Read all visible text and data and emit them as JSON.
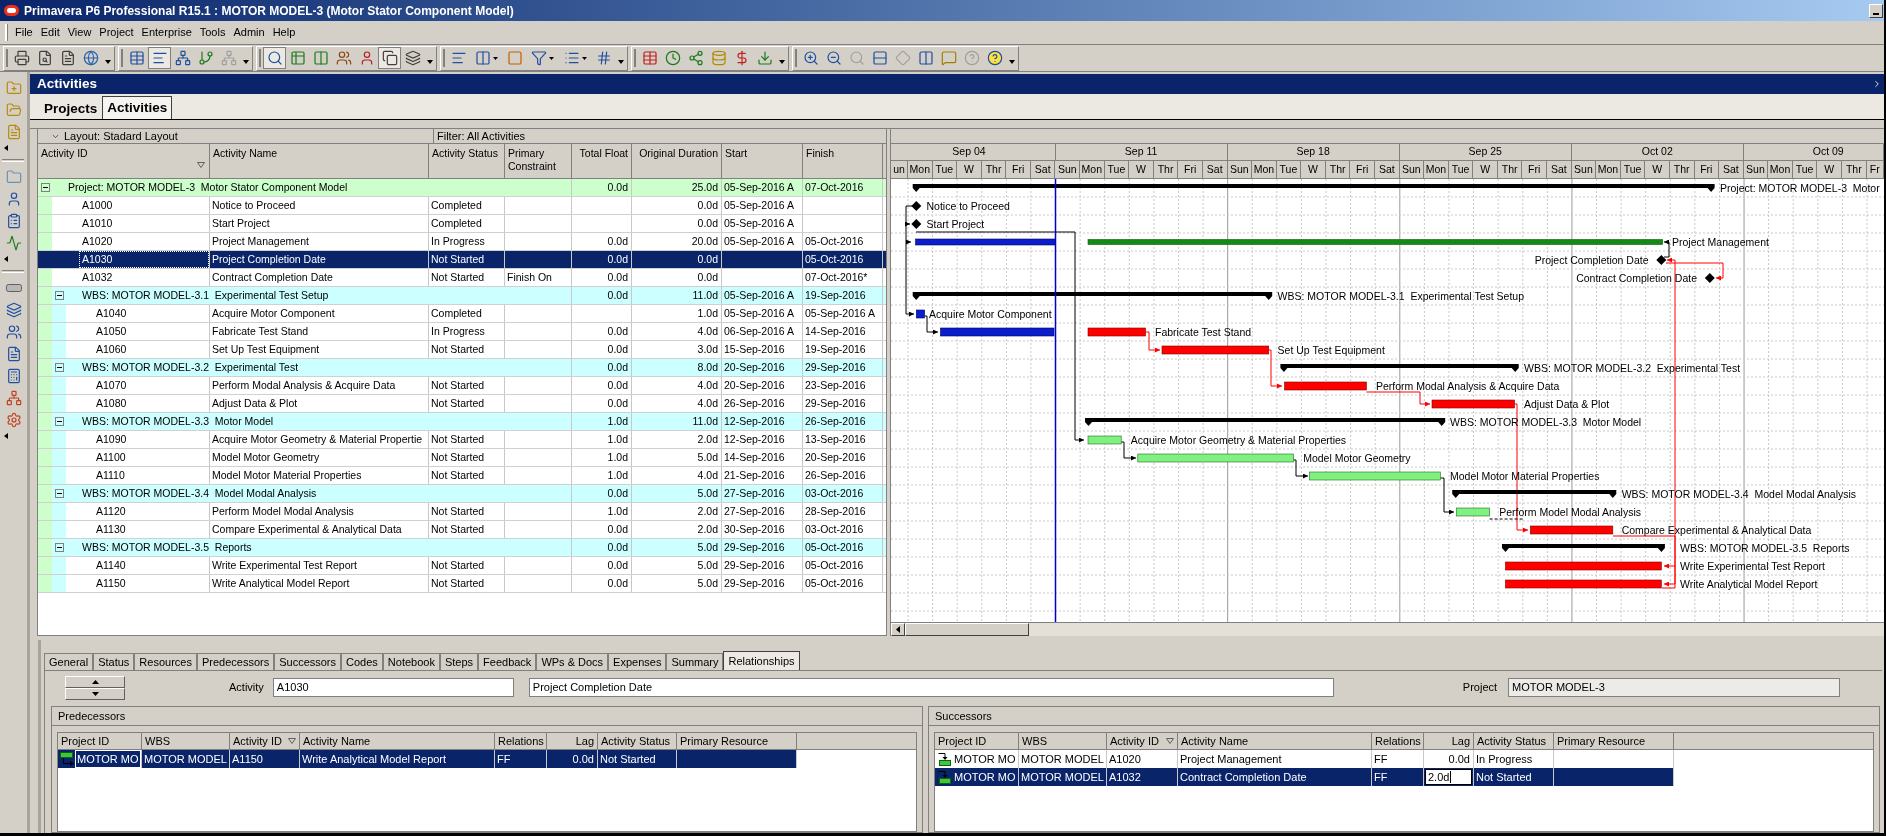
{
  "window": {
    "title": "Primavera P6 Professional R15.1 : MOTOR MODEL-3 (Motor Stator Component Model)"
  },
  "menu": [
    "File",
    "Edit",
    "View",
    "Project",
    "Enterprise",
    "Tools",
    "Admin",
    "Help"
  ],
  "toolbar": [
    {
      "buttons": [
        {
          "kind": "print",
          "pressed": false,
          "disabled": false,
          "dropdown": false
        },
        {
          "kind": "print_preview",
          "pressed": false,
          "disabled": false,
          "dropdown": false
        },
        {
          "kind": "page_setup",
          "pressed": false,
          "disabled": false,
          "dropdown": false
        },
        {
          "kind": "publish",
          "pressed": false,
          "disabled": false,
          "dropdown": false
        }
      ]
    },
    {
      "buttons": [
        {
          "kind": "table",
          "pressed": false,
          "disabled": false,
          "dropdown": false
        },
        {
          "kind": "gantt",
          "pressed": true,
          "disabled": false,
          "dropdown": false
        },
        {
          "kind": "network",
          "pressed": false,
          "disabled": false,
          "dropdown": false
        },
        {
          "kind": "trace_logic",
          "pressed": false,
          "disabled": false,
          "dropdown": false
        },
        {
          "kind": "hierarchy",
          "pressed": false,
          "disabled": true,
          "dropdown": false
        }
      ]
    },
    {
      "buttons": [
        {
          "kind": "details",
          "pressed": true,
          "disabled": false,
          "dropdown": false
        },
        {
          "kind": "activity_table",
          "pressed": false,
          "disabled": false,
          "dropdown": false
        },
        {
          "kind": "histogram",
          "pressed": false,
          "disabled": false,
          "dropdown": false
        },
        {
          "kind": "resource_usage",
          "pressed": false,
          "disabled": false,
          "dropdown": false
        },
        {
          "kind": "resource_profile",
          "pressed": false,
          "disabled": false,
          "dropdown": false
        },
        {
          "kind": "assignments",
          "pressed": true,
          "disabled": false,
          "dropdown": false
        },
        {
          "kind": "layers",
          "pressed": false,
          "disabled": false,
          "dropdown": false
        }
      ]
    },
    {
      "buttons": [
        {
          "kind": "bars",
          "pressed": false,
          "disabled": false,
          "dropdown": false
        },
        {
          "kind": "columns",
          "pressed": false,
          "disabled": false,
          "dropdown": true
        },
        {
          "kind": "filter_bar",
          "pressed": false,
          "disabled": false,
          "dropdown": false
        },
        {
          "kind": "filter",
          "pressed": false,
          "disabled": false,
          "dropdown": true
        },
        {
          "kind": "group",
          "pressed": false,
          "disabled": false,
          "dropdown": true
        },
        {
          "kind": "number",
          "pressed": false,
          "disabled": false,
          "dropdown": false
        }
      ]
    },
    {
      "buttons": [
        {
          "kind": "spreadsheet",
          "pressed": false,
          "disabled": false,
          "dropdown": false
        },
        {
          "kind": "schedule",
          "pressed": false,
          "disabled": false,
          "dropdown": false
        },
        {
          "kind": "level",
          "pressed": false,
          "disabled": false,
          "dropdown": false
        },
        {
          "kind": "store",
          "pressed": false,
          "disabled": false,
          "dropdown": false
        },
        {
          "kind": "dollar",
          "pressed": false,
          "disabled": false,
          "dropdown": false
        },
        {
          "kind": "update",
          "pressed": false,
          "disabled": false,
          "dropdown": false
        }
      ]
    },
    {
      "buttons": [
        {
          "kind": "zoom_in",
          "pressed": false,
          "disabled": false,
          "dropdown": false
        },
        {
          "kind": "zoom_out",
          "pressed": false,
          "disabled": false,
          "dropdown": false
        },
        {
          "kind": "zoom_fit",
          "pressed": false,
          "disabled": true,
          "dropdown": false
        },
        {
          "kind": "rows",
          "pressed": false,
          "disabled": false,
          "dropdown": false
        },
        {
          "kind": "diamond",
          "pressed": false,
          "disabled": true,
          "dropdown": false
        },
        {
          "kind": "columns2",
          "pressed": false,
          "disabled": false,
          "dropdown": false
        },
        {
          "kind": "comment",
          "pressed": false,
          "disabled": false,
          "dropdown": false
        },
        {
          "kind": "help",
          "pressed": false,
          "disabled": true,
          "dropdown": false
        },
        {
          "kind": "help_online",
          "pressed": false,
          "disabled": false,
          "dropdown": false
        }
      ]
    }
  ],
  "panel": {
    "title": "Activities"
  },
  "tabs": [
    {
      "label": "Projects",
      "selected": false
    },
    {
      "label": "Activities",
      "selected": true
    }
  ],
  "layout_bar": {
    "layout": "Layout: Stadard Layout",
    "filter": "Filter: All Activities"
  },
  "table": {
    "columns": [
      {
        "label": "Activity ID",
        "sorted": true
      },
      {
        "label": "Activity Name",
        "sorted": false
      },
      {
        "label": "Activity Status",
        "sorted": false
      },
      {
        "label": "Primary Constraint",
        "sorted": false
      },
      {
        "label": "Total Float",
        "sorted": false
      },
      {
        "label": "Original Duration",
        "sorted": false
      },
      {
        "label": "Start",
        "sorted": false
      },
      {
        "label": "Finish",
        "sorted": false
      }
    ],
    "rows": [
      {
        "kind": "project",
        "label": "Project: MOTOR MODEL-3  Motor Stator Component Model",
        "expanded": true,
        "selected": false,
        "total_float": "0.0d",
        "original_duration": "25.0d",
        "start": "05-Sep-2016 A",
        "finish": "07-Oct-2016",
        "children": [
          {
            "kind": "activity",
            "id": "A1000",
            "name": "Notice to Proceed",
            "status": "Completed",
            "original_duration": "0.0d",
            "start": "05-Sep-2016 A",
            "selected": false
          },
          {
            "kind": "activity",
            "id": "A1010",
            "name": "Start Project",
            "status": "Completed",
            "original_duration": "0.0d",
            "start": "05-Sep-2016 A",
            "selected": false
          },
          {
            "kind": "activity",
            "id": "A1020",
            "name": "Project Management",
            "status": "In Progress",
            "total_float": "0.0d",
            "original_duration": "20.0d",
            "start": "05-Sep-2016 A",
            "finish": "05-Oct-2016",
            "selected": false
          },
          {
            "kind": "activity",
            "id": "A1030",
            "name": "Project Completion Date",
            "status": "Not Started",
            "total_float": "0.0d",
            "original_duration": "0.0d",
            "finish": "05-Oct-2016",
            "selected": true
          },
          {
            "kind": "activity",
            "id": "A1032",
            "name": "Contract Completion Date",
            "status": "Not Started",
            "primary_constraint": "Finish On",
            "total_float": "0.0d",
            "original_duration": "0.0d",
            "finish": "07-Oct-2016*",
            "selected": false
          },
          {
            "kind": "wbs",
            "label": "WBS: MOTOR MODEL-3.1  Experimental Test Setup",
            "expanded": true,
            "selected": false,
            "total_float": "0.0d",
            "original_duration": "11.0d",
            "start": "05-Sep-2016 A",
            "finish": "19-Sep-2016",
            "children": [
              {
                "kind": "activity",
                "id": "A1040",
                "name": "Acquire Motor Component",
                "status": "Completed",
                "original_duration": "1.0d",
                "start": "05-Sep-2016 A",
                "finish": "05-Sep-2016 A",
                "selected": false
              },
              {
                "kind": "activity",
                "id": "A1050",
                "name": "Fabricate Test Stand",
                "status": "In Progress",
                "total_float": "0.0d",
                "original_duration": "4.0d",
                "start": "06-Sep-2016 A",
                "finish": "14-Sep-2016",
                "selected": false
              },
              {
                "kind": "activity",
                "id": "A1060",
                "name": "Set Up Test Equipment",
                "status": "Not Started",
                "total_float": "0.0d",
                "original_duration": "3.0d",
                "start": "15-Sep-2016",
                "finish": "19-Sep-2016",
                "selected": false
              }
            ]
          },
          {
            "kind": "wbs",
            "label": "WBS: MOTOR MODEL-3.2  Experimental Test",
            "expanded": true,
            "selected": false,
            "total_float": "0.0d",
            "original_duration": "8.0d",
            "start": "20-Sep-2016",
            "finish": "29-Sep-2016",
            "children": [
              {
                "kind": "activity",
                "id": "A1070",
                "name": "Perform Modal Analysis & Acquire Data",
                "status": "Not Started",
                "total_float": "0.0d",
                "original_duration": "4.0d",
                "start": "20-Sep-2016",
                "finish": "23-Sep-2016",
                "selected": false
              },
              {
                "kind": "activity",
                "id": "A1080",
                "name": "Adjust Data & Plot",
                "status": "Not Started",
                "total_float": "0.0d",
                "original_duration": "4.0d",
                "start": "26-Sep-2016",
                "finish": "29-Sep-2016",
                "selected": false
              }
            ]
          },
          {
            "kind": "wbs",
            "label": "WBS: MOTOR MODEL-3.3  Motor Model",
            "expanded": true,
            "selected": false,
            "total_float": "1.0d",
            "original_duration": "11.0d",
            "start": "12-Sep-2016",
            "finish": "26-Sep-2016",
            "children": [
              {
                "kind": "activity",
                "id": "A1090",
                "name": "Acquire Motor Geometry & Material Propertie",
                "status": "Not Started",
                "total_float": "1.0d",
                "original_duration": "2.0d",
                "start": "12-Sep-2016",
                "finish": "13-Sep-2016",
                "selected": false
              },
              {
                "kind": "activity",
                "id": "A1100",
                "name": "Model Motor Geometry",
                "status": "Not Started",
                "total_float": "1.0d",
                "original_duration": "5.0d",
                "start": "14-Sep-2016",
                "finish": "20-Sep-2016",
                "selected": false
              },
              {
                "kind": "activity",
                "id": "A1110",
                "name": "Model Motor Material Properties",
                "status": "Not Started",
                "total_float": "1.0d",
                "original_duration": "4.0d",
                "start": "21-Sep-2016",
                "finish": "26-Sep-2016",
                "selected": false
              }
            ]
          },
          {
            "kind": "wbs",
            "label": "WBS: MOTOR MODEL-3.4  Model Modal Analysis",
            "expanded": true,
            "selected": false,
            "total_float": "0.0d",
            "original_duration": "5.0d",
            "start": "27-Sep-2016",
            "finish": "03-Oct-2016",
            "children": [
              {
                "kind": "activity",
                "id": "A1120",
                "name": "Perform Model Modal Analysis",
                "status": "Not Started",
                "total_float": "1.0d",
                "original_duration": "2.0d",
                "start": "27-Sep-2016",
                "finish": "28-Sep-2016",
                "selected": false
              },
              {
                "kind": "activity",
                "id": "A1130",
                "name": "Compare Experimental & Analytical Data",
                "status": "Not Started",
                "total_float": "0.0d",
                "original_duration": "2.0d",
                "start": "30-Sep-2016",
                "finish": "03-Oct-2016",
                "selected": false
              }
            ]
          },
          {
            "kind": "wbs",
            "label": "WBS: MOTOR MODEL-3.5  Reports",
            "expanded": true,
            "selected": false,
            "total_float": "0.0d",
            "original_duration": "5.0d",
            "start": "29-Sep-2016",
            "finish": "05-Oct-2016",
            "children": [
              {
                "kind": "activity",
                "id": "A1140",
                "name": "Write Experimental Test Report",
                "status": "Not Started",
                "total_float": "0.0d",
                "original_duration": "5.0d",
                "start": "29-Sep-2016",
                "finish": "05-Oct-2016",
                "selected": false
              },
              {
                "kind": "activity",
                "id": "A1150",
                "name": "Write Analytical Model Report",
                "status": "Not Started",
                "total_float": "0.0d",
                "original_duration": "5.0d",
                "start": "29-Sep-2016",
                "finish": "05-Oct-2016",
                "selected": false
              }
            ]
          }
        ]
      }
    ]
  },
  "gantt": {
    "weeks": [
      "Sep 04",
      "Sep 11",
      "Sep 18",
      "Sep 25",
      "Oct 02",
      "Oct 09"
    ],
    "days": [
      "un",
      "Mon",
      "Tue",
      "W",
      "Thr",
      "Fri",
      "Sat",
      "Sun",
      "Mon",
      "Tue",
      "W",
      "Thr",
      "Fri",
      "Sat",
      "Sun",
      "Mon",
      "Tue",
      "W",
      "Thr",
      "Fri",
      "Sat",
      "Sun",
      "Mon",
      "Tue",
      "W",
      "Thr",
      "Fri",
      "Sat",
      "Sun",
      "Mon",
      "Tue",
      "W",
      "Thr",
      "Fri",
      "Sat",
      "Sun",
      "Mon",
      "Tue",
      "W",
      "Thr",
      "Fr"
    ],
    "bars": [
      {
        "kind": "summary",
        "label": "Project: MOTOR MODEL-3  Motor"
      },
      {
        "kind": "milestone",
        "label": "Notice to Proceed"
      },
      {
        "kind": "milestone",
        "label": "Start Project"
      },
      {
        "kind": "progress",
        "label": "Project Management"
      },
      {
        "kind": "milestone",
        "label": "Project Completion Date"
      },
      {
        "kind": "milestone",
        "label": "Contract Completion Date"
      },
      {
        "kind": "summary",
        "label": "WBS: MOTOR MODEL-3.1  Experimental Test Setup"
      },
      {
        "kind": "actual",
        "label": "Acquire Motor Component"
      },
      {
        "kind": "progress_critical",
        "label": "Fabricate Test Stand"
      },
      {
        "kind": "critical",
        "label": "Set Up Test Equipment"
      },
      {
        "kind": "summary",
        "label": "WBS: MOTOR MODEL-3.2  Experimental Test"
      },
      {
        "kind": "critical",
        "label": "Perform Modal Analysis & Acquire Data"
      },
      {
        "kind": "critical",
        "label": "Adjust Data & Plot"
      },
      {
        "kind": "summary",
        "label": "WBS: MOTOR MODEL-3.3  Motor Model"
      },
      {
        "kind": "remaining",
        "label": "Acquire Motor Geometry & Material Properties"
      },
      {
        "kind": "remaining",
        "label": "Model Motor Geometry"
      },
      {
        "kind": "remaining",
        "label": "Model Motor Material Properties"
      },
      {
        "kind": "summary",
        "label": "WBS: MOTOR MODEL-3.4  Model Modal Analysis"
      },
      {
        "kind": "remaining",
        "label": "Perform Model Modal Analysis"
      },
      {
        "kind": "critical",
        "label": "Compare Experimental & Analytical Data"
      },
      {
        "kind": "summary",
        "label": "WBS: MOTOR MODEL-3.5  Reports"
      },
      {
        "kind": "critical",
        "label": "Write Experimental Test Report"
      },
      {
        "kind": "critical",
        "label": "Write Analytical Model Report"
      }
    ]
  },
  "details": {
    "tabs": [
      {
        "label": "General",
        "selected": false
      },
      {
        "label": "Status",
        "selected": false
      },
      {
        "label": "Resources",
        "selected": false
      },
      {
        "label": "Predecessors",
        "selected": false
      },
      {
        "label": "Successors",
        "selected": false
      },
      {
        "label": "Codes",
        "selected": false
      },
      {
        "label": "Notebook",
        "selected": false
      },
      {
        "label": "Steps",
        "selected": false
      },
      {
        "label": "Feedback",
        "selected": false
      },
      {
        "label": "WPs & Docs",
        "selected": false
      },
      {
        "label": "Expenses",
        "selected": false
      },
      {
        "label": "Summary",
        "selected": false
      },
      {
        "label": "Relationships",
        "selected": true
      }
    ],
    "activity": {
      "label": "Activity",
      "id": "A1030",
      "name": "Project Completion Date",
      "disabled": false
    },
    "project": {
      "label": "Project",
      "value": "MOTOR MODEL-3",
      "disabled": true
    },
    "predecessors": {
      "title": "Predecessors",
      "columns": [
        {
          "label": "Project ID",
          "sorted": false
        },
        {
          "label": "WBS",
          "sorted": false
        },
        {
          "label": "Activity ID",
          "sorted": true
        },
        {
          "label": "Activity Name",
          "sorted": false
        },
        {
          "label": "Relations",
          "sorted": false
        },
        {
          "label": "Lag",
          "sorted": false
        },
        {
          "label": "Activity Status",
          "sorted": false
        },
        {
          "label": "Primary Resource",
          "sorted": false
        }
      ],
      "rows": [
        {
          "project_id": "MOTOR MO",
          "wbs": "MOTOR MODEL",
          "activity_id": "A1150",
          "activity_name": "Write Analytical Model Report",
          "relations": "FF",
          "lag": "0.0d",
          "activity_status": "Not Started",
          "selected": true,
          "editing": false
        }
      ]
    },
    "successors": {
      "title": "Successors",
      "columns": [
        {
          "label": "Project ID",
          "sorted": false
        },
        {
          "label": "WBS",
          "sorted": false
        },
        {
          "label": "Activity ID",
          "sorted": true
        },
        {
          "label": "Activity Name",
          "sorted": false
        },
        {
          "label": "Relations",
          "sorted": false
        },
        {
          "label": "Lag",
          "sorted": false
        },
        {
          "label": "Activity Status",
          "sorted": false
        },
        {
          "label": "Primary Resource",
          "sorted": false
        }
      ],
      "rows": [
        {
          "project_id": "MOTOR MO",
          "wbs": "MOTOR MODEL",
          "activity_id": "A1020",
          "activity_name": "Project Management",
          "relations": "FF",
          "lag": "0.0d",
          "activity_status": "In Progress",
          "selected": false,
          "editing": false
        },
        {
          "project_id": "MOTOR MO",
          "wbs": "MOTOR MODEL",
          "activity_id": "A1032",
          "activity_name": "Contract Completion Date",
          "relations": "FF",
          "lag": "2.0d",
          "activity_status": "Not Started",
          "selected": true,
          "editing": true
        }
      ]
    }
  }
}
